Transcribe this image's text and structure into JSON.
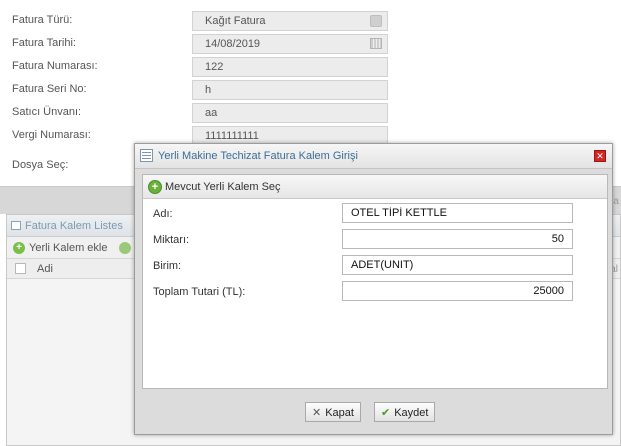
{
  "form": {
    "rows": [
      {
        "label": "Fatura Türü:",
        "value": "Kağıt Fatura"
      },
      {
        "label": "Fatura Tarihi:",
        "value": "14/08/2019"
      },
      {
        "label": "Fatura Numarası:",
        "value": "122"
      },
      {
        "label": "Fatura Seri No:",
        "value": "h"
      },
      {
        "label": "Satıcı Ünvanı:",
        "value": "aa"
      },
      {
        "label": "Vergi Numarası:",
        "value": "1111111111"
      },
      {
        "label": "Dosya Seç:",
        "value": ""
      }
    ]
  },
  "items_panel": {
    "title": "Fatura Kalem Listes",
    "add_label": "Yerli Kalem ekle",
    "column_name": "Adi",
    "right_fragment_1": "(la",
    "right_fragment_2": "al"
  },
  "modal": {
    "title": "Yerli Makine Techizat Fatura Kalem Girişi",
    "select_existing_label": "Mevcut Yerli Kalem Seç",
    "fields": {
      "name": {
        "label": "Adı:",
        "value": "OTEL TİPİ KETTLE"
      },
      "quantity": {
        "label": "Miktarı:",
        "value": "50"
      },
      "unit": {
        "label": "Birim:",
        "value": "ADET(UNIT)"
      },
      "total": {
        "label": "Toplam Tutari (TL):",
        "value": "25000"
      }
    },
    "buttons": {
      "close": "Kapat",
      "save": "Kaydet"
    }
  },
  "colors": {
    "title_text": "#3c6e96",
    "close_red": "#d52626",
    "add_green": "#69b13a"
  }
}
